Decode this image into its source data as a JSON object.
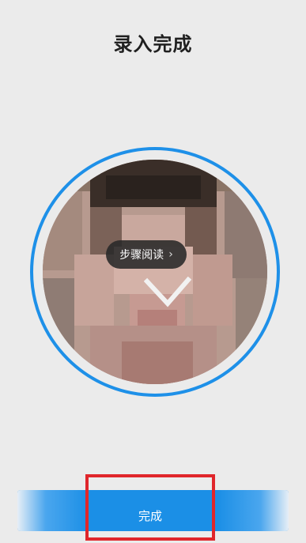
{
  "header": {
    "title": "录入完成"
  },
  "face": {
    "icon": "checkmark-icon",
    "ring_color": "#1e90e8"
  },
  "step_read": {
    "label": "步骤阅读",
    "chevron": "›"
  },
  "footer": {
    "done_label": "完成",
    "button_color": "#1b8fe6",
    "highlight_color": "#e0262b"
  }
}
